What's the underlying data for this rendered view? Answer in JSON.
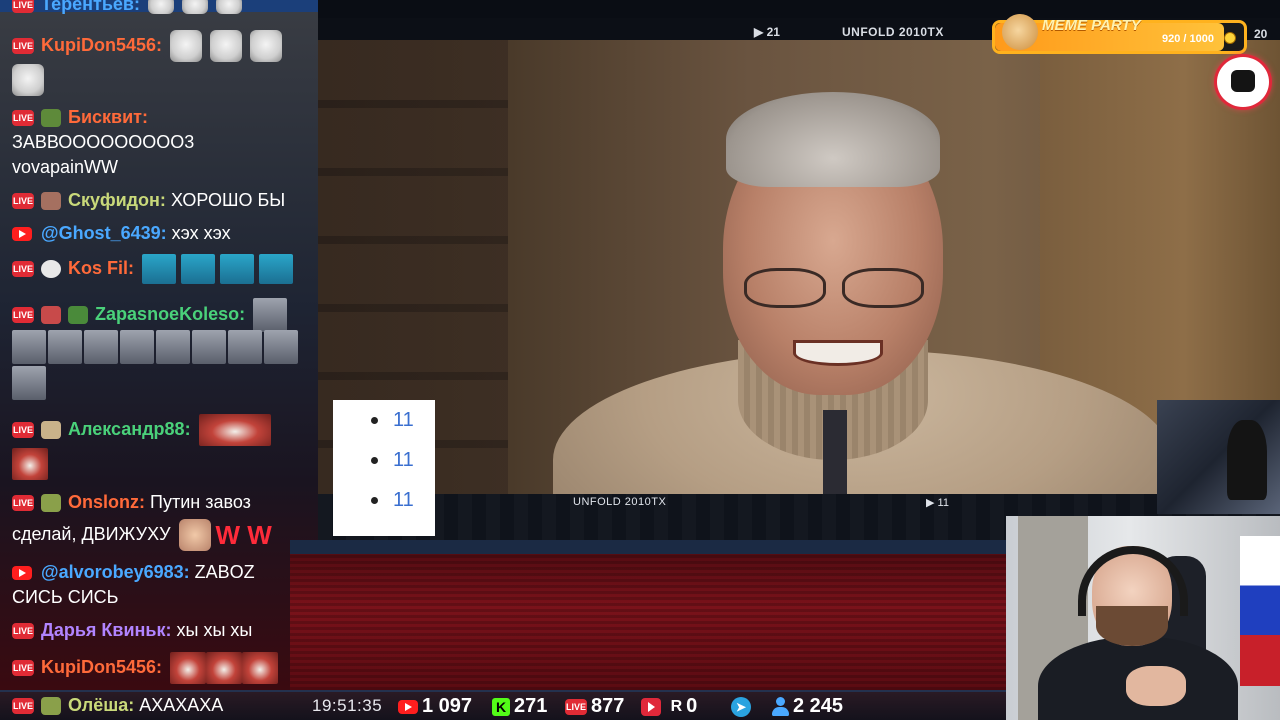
{
  "video": {
    "overlay_top_text": "UNFOLD 2010TX",
    "overlay_top_left_num": "▶ 21",
    "overlay_top_right_num": "20",
    "overlay_bottom_text": "UNFOLD 2010TX",
    "overlay_bottom_num": "▶ 11"
  },
  "popup_list": {
    "items": [
      "11",
      "11",
      "11"
    ]
  },
  "meme_party": {
    "title": "MEME PARTY",
    "count": "920 / 1000",
    "progress": 0.92
  },
  "chat": {
    "messages": [
      {
        "platform": "live",
        "user": "Терентьев:",
        "user_color": "#4aa8ff",
        "text": ""
      },
      {
        "platform": "live",
        "user": "KupiDon5456:",
        "user_color": "#ff6a3a",
        "text": ""
      },
      {
        "platform": "live",
        "user": "Бисквит:",
        "user_color": "#ff6a3a",
        "text": ""
      },
      {
        "platform": "",
        "user": "",
        "user_color": "#ffffff",
        "text": "ЗАВВООООООООО3"
      },
      {
        "platform": "",
        "user": "",
        "user_color": "#ffffff",
        "text": "vovapainWW"
      },
      {
        "platform": "live",
        "user": "Скуфидон:",
        "user_color": "#c9d97a",
        "text": "ХОРОШО БЫ"
      },
      {
        "platform": "youtube",
        "user": "@Ghost_6439:",
        "user_color": "#4aa8ff",
        "text": "хэх хэх"
      },
      {
        "platform": "live",
        "user": "Kos Fil:",
        "user_color": "#ff6a3a",
        "text": ""
      },
      {
        "platform": "live",
        "user": "ZapasnoeKoleso:",
        "user_color": "#4ad17a",
        "text": ""
      },
      {
        "platform": "live",
        "user": "Александр88:",
        "user_color": "#4ad17a",
        "text": ""
      },
      {
        "platform": "live",
        "user": "Onslonz:",
        "user_color": "#ff6a3a",
        "text": "Путин завоз"
      },
      {
        "platform": "",
        "user": "",
        "user_color": "#ffffff",
        "text": "сделай, ДВИЖУХУ"
      },
      {
        "platform": "youtube",
        "user": "@alvorobey6983:",
        "user_color": "#4aa8ff",
        "text": "ZABOZ"
      },
      {
        "platform": "",
        "user": "",
        "user_color": "#ffffff",
        "text": "СИСЬ СИСЬ"
      },
      {
        "platform": "live",
        "user": "Дарья Квиньк:",
        "user_color": "#b184ff",
        "text": "хы хы хы"
      },
      {
        "platform": "live",
        "user": "KupiDon5456:",
        "user_color": "#ff6a3a",
        "text": ""
      },
      {
        "platform": "live",
        "user": "Олёша:",
        "user_color": "#c9d97a",
        "text": "АХАХАХА"
      }
    ],
    "emote_label_gubami": "ГУБАМИ",
    "ww_text": "W W"
  },
  "statsbar": {
    "time": "19:51:35",
    "youtube_count": "1 097",
    "kick_count": "271",
    "vklive_count": "877",
    "rutube_count": "0",
    "telegram_count": "",
    "viewers_count": "2 245"
  },
  "colors": {
    "live_badge": "#e02b35",
    "youtube": "#ff1e1e",
    "kick": "#53fc18",
    "telegram": "#2aa3e0",
    "meme_orange": "#ffb21e"
  }
}
